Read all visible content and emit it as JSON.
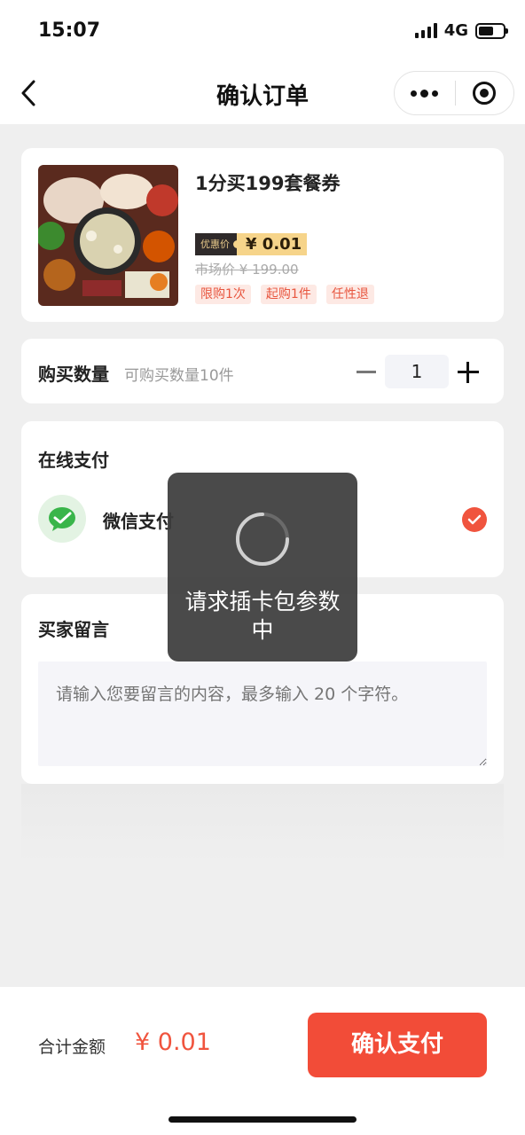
{
  "status_bar": {
    "time": "15:07",
    "network": "4G"
  },
  "nav": {
    "title": "确认订单"
  },
  "product": {
    "name": "1分买199套餐券",
    "price_tag": "优惠价",
    "price": "¥ 0.01",
    "market_price": "市场价 ¥ 199.00",
    "tags": [
      "限购1次",
      "起购1件",
      "任性退"
    ]
  },
  "quantity": {
    "label": "购买数量",
    "hint": "可购买数量10件",
    "value": "1"
  },
  "payment": {
    "title": "在线支付",
    "method": "微信支付"
  },
  "message": {
    "title": "买家留言",
    "placeholder": "请输入您要留言的内容，最多输入 20 个字符。"
  },
  "toast": {
    "text": "请求插卡包参数中"
  },
  "footer": {
    "total_label": "合计金额",
    "total_value": "¥ 0.01",
    "pay_button": "确认支付"
  },
  "colors": {
    "accent": "#f24c38",
    "price_tag_bg": "#2f2a2a",
    "price_bg": "#f6d48a",
    "wechat_green": "#39b54a"
  }
}
